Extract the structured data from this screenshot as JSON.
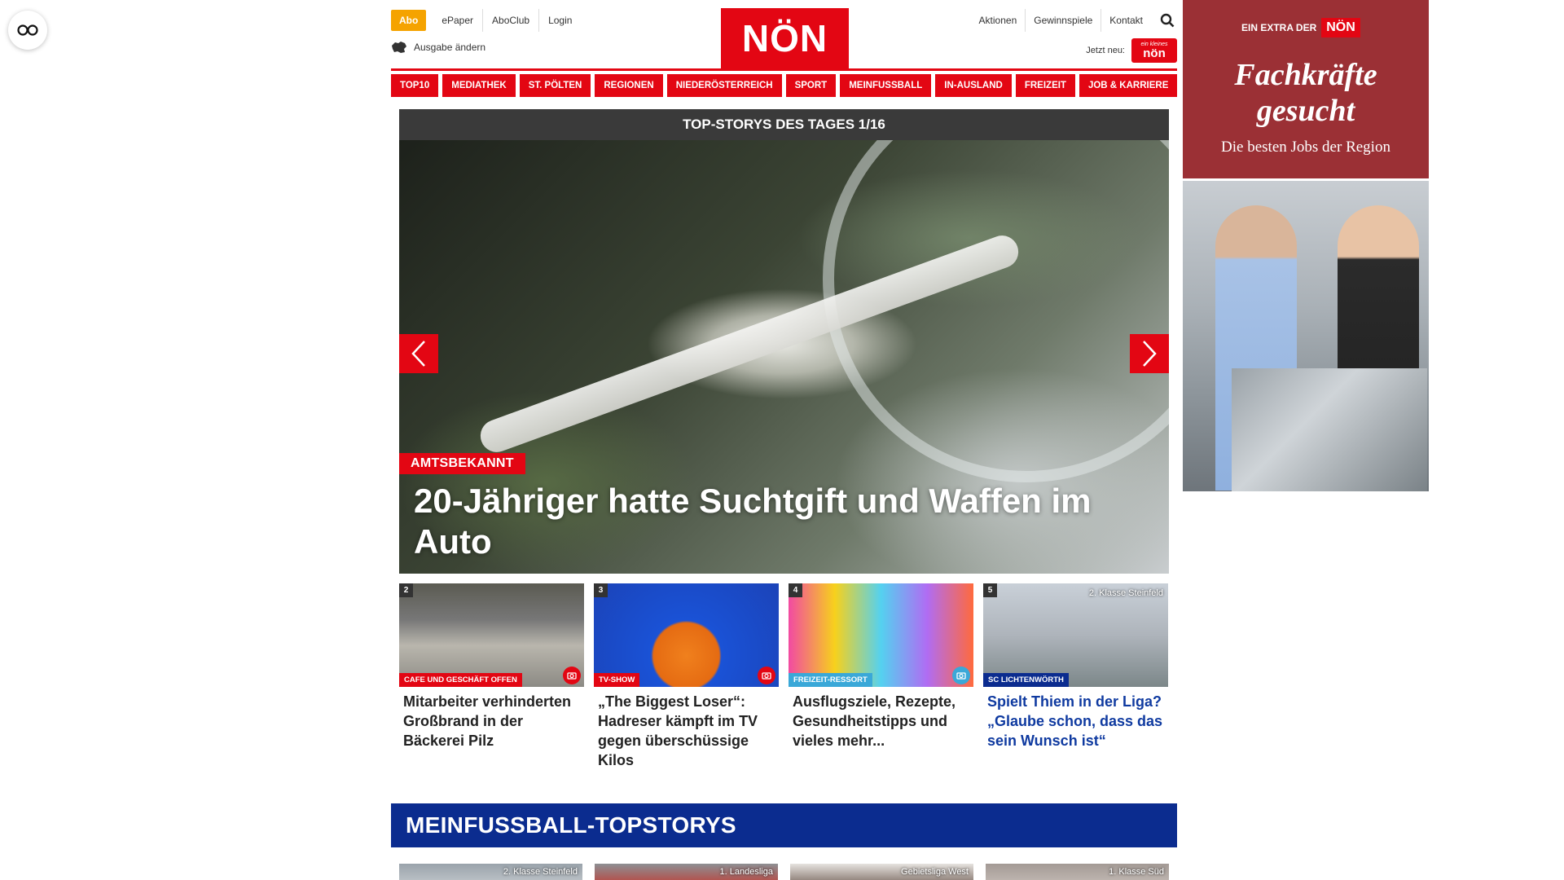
{
  "top": {
    "abo": "Abo",
    "links_left": [
      "ePaper",
      "AboClub",
      "Login"
    ],
    "ausgabe": "Ausgabe ändern",
    "logo": "NÖN",
    "links_right": [
      "Aktionen",
      "Gewinnspiele",
      "Kontakt"
    ],
    "jetzt_neu": "Jetzt neu:",
    "mini_logo_small": "ein kleines",
    "mini_logo": "nön"
  },
  "nav": [
    "TOP10",
    "MEDIATHEK",
    "ST. PÖLTEN",
    "REGIONEN",
    "NIEDERÖSTERREICH",
    "SPORT",
    "MEINFUSSBALL",
    "IN-AUSLAND",
    "FREIZEIT",
    "JOB & KARRIERE"
  ],
  "slider": {
    "header": "TOP-STORYS DES TAGES 1/16",
    "tag": "AMTSBEKANNT",
    "title": "20-Jähriger hatte Suchtgift und Waffen im Auto"
  },
  "teasers": [
    {
      "num": "2",
      "tag": "CAFE UND GESCHÄFT OFFEN",
      "tag_color": "#e30613",
      "title": "Mitarbeiter verhinderten Großbrand in der Bäckerei Pilz",
      "overlay": "",
      "cam_color": "#e30613",
      "blue": false
    },
    {
      "num": "3",
      "tag": "TV-SHOW",
      "tag_color": "#e30613",
      "title": "„The Biggest Loser“: Hadreser kämpft im TV gegen überschüssige Kilos",
      "overlay": "",
      "cam_color": "#e30613",
      "blue": false
    },
    {
      "num": "4",
      "tag": "FREIZEIT-RESSORT",
      "tag_color": "#3aa8d8",
      "title": "Ausflugsziele, Rezepte, Gesundheitstipps und vieles mehr...",
      "overlay": "",
      "cam_color": "#3aa8d8",
      "blue": false
    },
    {
      "num": "5",
      "tag": "SC LICHTENWÖRTH",
      "tag_color": "#0b2c8f",
      "title": "Spielt Thiem in der Liga? „Glaube schon, dass das sein Wunsch ist“",
      "overlay": "2. Klasse Steinfeld",
      "cam_color": "",
      "blue": true
    }
  ],
  "meinfussball": {
    "title": "MEINFUSSBALL-TOPSTORYS",
    "thumbs": [
      "2. Klasse Steinfeld",
      "1. Landesliga",
      "Gebietsliga West",
      "1. Klasse Süd"
    ]
  },
  "ad": {
    "extra": "EIN EXTRA DER",
    "logo": "NÖN",
    "headline_1": "Fachkräfte",
    "headline_2": "gesucht",
    "sub": "Die besten Jobs der Region"
  },
  "colors": {
    "brand_red": "#e30613",
    "fussball_blue": "#0b2c8f",
    "abo_orange": "#f5a300"
  }
}
